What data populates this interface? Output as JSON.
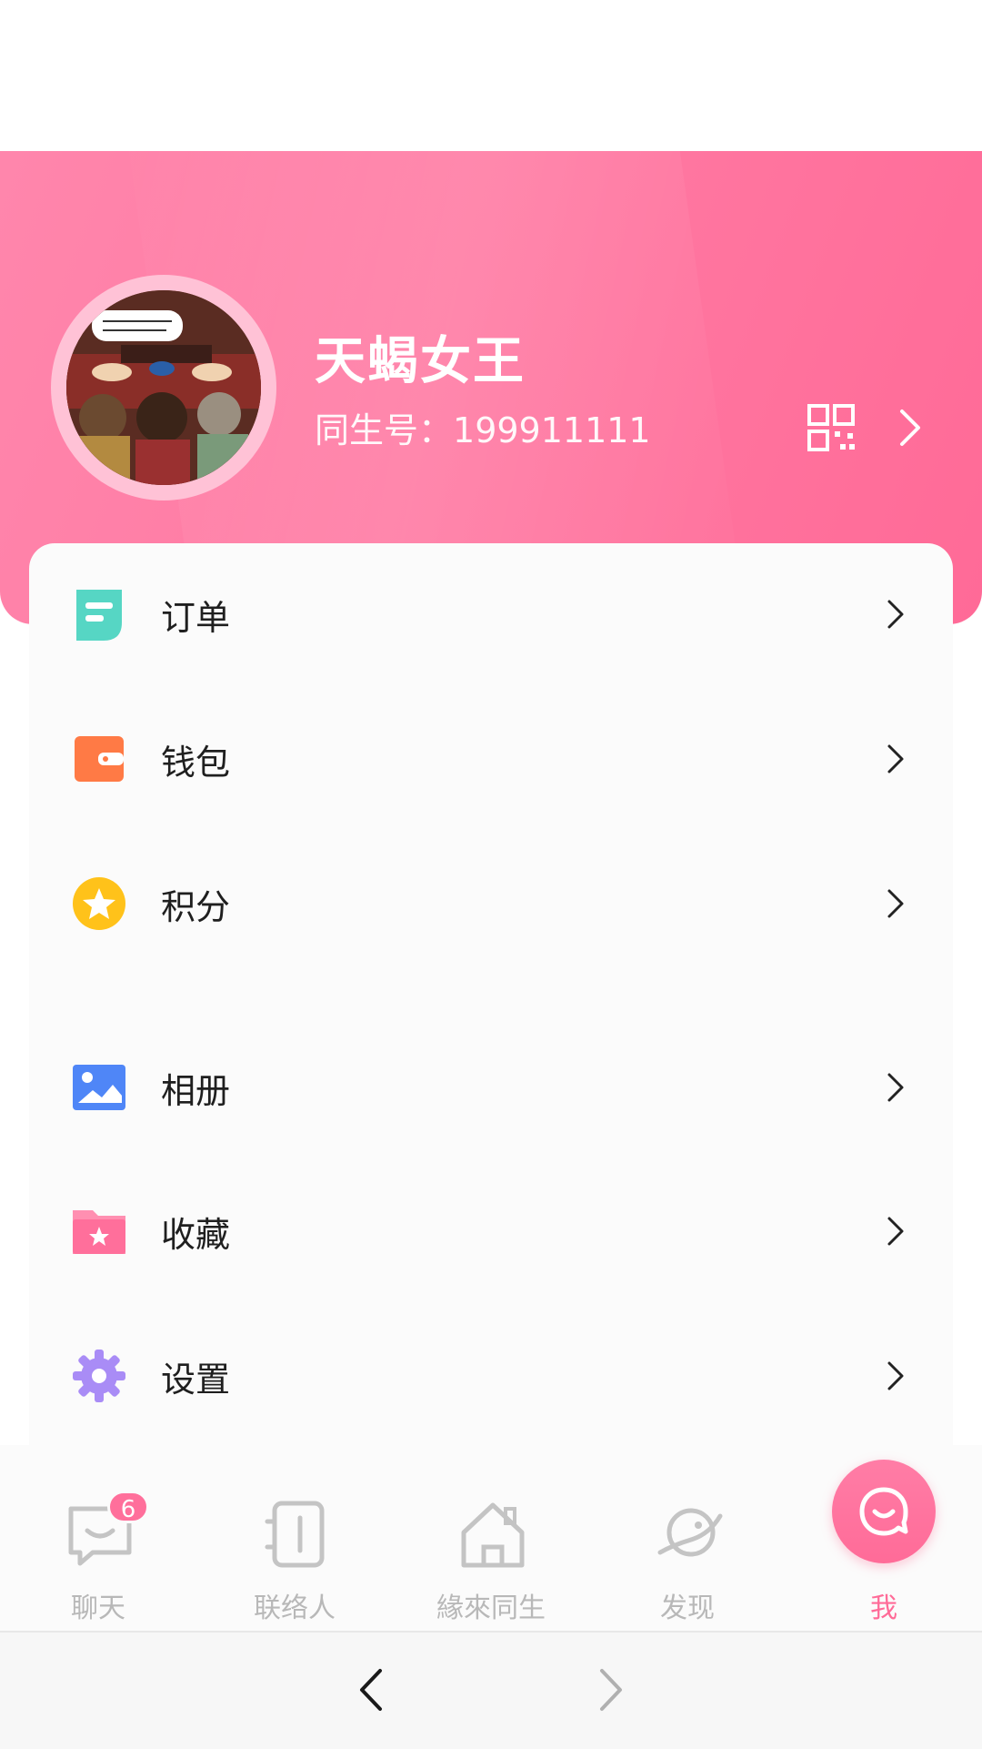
{
  "profile": {
    "name": "天蝎女王",
    "id_label": "同生号：",
    "id_value": "199911111"
  },
  "menu": {
    "items": [
      {
        "label": "订单",
        "icon": "order-icon",
        "color": "#56d6c4"
      },
      {
        "label": "钱包",
        "icon": "wallet-icon",
        "color": "#ff7a45"
      },
      {
        "label": "积分",
        "icon": "points-star-icon",
        "color": "#ffc21a"
      },
      {
        "label": "相册",
        "icon": "album-icon",
        "color": "#4f86f7"
      },
      {
        "label": "收藏",
        "icon": "favorite-folder-icon",
        "color": "#ff6f9b"
      },
      {
        "label": "设置",
        "icon": "settings-gear-icon",
        "color": "#a98cf6"
      }
    ]
  },
  "tabbar": {
    "tabs": [
      {
        "label": "聊天",
        "icon": "chat-icon",
        "badge": "6"
      },
      {
        "label": "联络人",
        "icon": "contacts-icon"
      },
      {
        "label": "緣來同生",
        "icon": "home-icon"
      },
      {
        "label": "发现",
        "icon": "planet-icon"
      },
      {
        "label": "我",
        "icon": "me-face-icon",
        "active": true
      }
    ]
  },
  "colors": {
    "brand_pink": "#ff7aa3",
    "active_tab": "#ff6b98",
    "inactive_tab": "#b8b8b8"
  }
}
